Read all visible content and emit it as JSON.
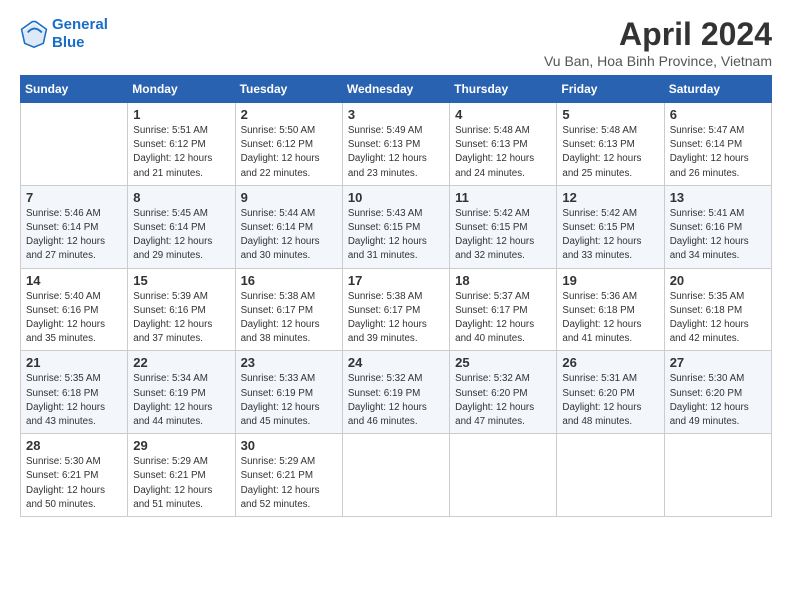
{
  "logo": {
    "line1": "General",
    "line2": "Blue"
  },
  "title": "April 2024",
  "subtitle": "Vu Ban, Hoa Binh Province, Vietnam",
  "headers": [
    "Sunday",
    "Monday",
    "Tuesday",
    "Wednesday",
    "Thursday",
    "Friday",
    "Saturday"
  ],
  "weeks": [
    [
      {
        "num": "",
        "sunrise": "",
        "sunset": "",
        "daylight": ""
      },
      {
        "num": "1",
        "sunrise": "Sunrise: 5:51 AM",
        "sunset": "Sunset: 6:12 PM",
        "daylight": "Daylight: 12 hours and 21 minutes."
      },
      {
        "num": "2",
        "sunrise": "Sunrise: 5:50 AM",
        "sunset": "Sunset: 6:12 PM",
        "daylight": "Daylight: 12 hours and 22 minutes."
      },
      {
        "num": "3",
        "sunrise": "Sunrise: 5:49 AM",
        "sunset": "Sunset: 6:13 PM",
        "daylight": "Daylight: 12 hours and 23 minutes."
      },
      {
        "num": "4",
        "sunrise": "Sunrise: 5:48 AM",
        "sunset": "Sunset: 6:13 PM",
        "daylight": "Daylight: 12 hours and 24 minutes."
      },
      {
        "num": "5",
        "sunrise": "Sunrise: 5:48 AM",
        "sunset": "Sunset: 6:13 PM",
        "daylight": "Daylight: 12 hours and 25 minutes."
      },
      {
        "num": "6",
        "sunrise": "Sunrise: 5:47 AM",
        "sunset": "Sunset: 6:14 PM",
        "daylight": "Daylight: 12 hours and 26 minutes."
      }
    ],
    [
      {
        "num": "7",
        "sunrise": "Sunrise: 5:46 AM",
        "sunset": "Sunset: 6:14 PM",
        "daylight": "Daylight: 12 hours and 27 minutes."
      },
      {
        "num": "8",
        "sunrise": "Sunrise: 5:45 AM",
        "sunset": "Sunset: 6:14 PM",
        "daylight": "Daylight: 12 hours and 29 minutes."
      },
      {
        "num": "9",
        "sunrise": "Sunrise: 5:44 AM",
        "sunset": "Sunset: 6:14 PM",
        "daylight": "Daylight: 12 hours and 30 minutes."
      },
      {
        "num": "10",
        "sunrise": "Sunrise: 5:43 AM",
        "sunset": "Sunset: 6:15 PM",
        "daylight": "Daylight: 12 hours and 31 minutes."
      },
      {
        "num": "11",
        "sunrise": "Sunrise: 5:42 AM",
        "sunset": "Sunset: 6:15 PM",
        "daylight": "Daylight: 12 hours and 32 minutes."
      },
      {
        "num": "12",
        "sunrise": "Sunrise: 5:42 AM",
        "sunset": "Sunset: 6:15 PM",
        "daylight": "Daylight: 12 hours and 33 minutes."
      },
      {
        "num": "13",
        "sunrise": "Sunrise: 5:41 AM",
        "sunset": "Sunset: 6:16 PM",
        "daylight": "Daylight: 12 hours and 34 minutes."
      }
    ],
    [
      {
        "num": "14",
        "sunrise": "Sunrise: 5:40 AM",
        "sunset": "Sunset: 6:16 PM",
        "daylight": "Daylight: 12 hours and 35 minutes."
      },
      {
        "num": "15",
        "sunrise": "Sunrise: 5:39 AM",
        "sunset": "Sunset: 6:16 PM",
        "daylight": "Daylight: 12 hours and 37 minutes."
      },
      {
        "num": "16",
        "sunrise": "Sunrise: 5:38 AM",
        "sunset": "Sunset: 6:17 PM",
        "daylight": "Daylight: 12 hours and 38 minutes."
      },
      {
        "num": "17",
        "sunrise": "Sunrise: 5:38 AM",
        "sunset": "Sunset: 6:17 PM",
        "daylight": "Daylight: 12 hours and 39 minutes."
      },
      {
        "num": "18",
        "sunrise": "Sunrise: 5:37 AM",
        "sunset": "Sunset: 6:17 PM",
        "daylight": "Daylight: 12 hours and 40 minutes."
      },
      {
        "num": "19",
        "sunrise": "Sunrise: 5:36 AM",
        "sunset": "Sunset: 6:18 PM",
        "daylight": "Daylight: 12 hours and 41 minutes."
      },
      {
        "num": "20",
        "sunrise": "Sunrise: 5:35 AM",
        "sunset": "Sunset: 6:18 PM",
        "daylight": "Daylight: 12 hours and 42 minutes."
      }
    ],
    [
      {
        "num": "21",
        "sunrise": "Sunrise: 5:35 AM",
        "sunset": "Sunset: 6:18 PM",
        "daylight": "Daylight: 12 hours and 43 minutes."
      },
      {
        "num": "22",
        "sunrise": "Sunrise: 5:34 AM",
        "sunset": "Sunset: 6:19 PM",
        "daylight": "Daylight: 12 hours and 44 minutes."
      },
      {
        "num": "23",
        "sunrise": "Sunrise: 5:33 AM",
        "sunset": "Sunset: 6:19 PM",
        "daylight": "Daylight: 12 hours and 45 minutes."
      },
      {
        "num": "24",
        "sunrise": "Sunrise: 5:32 AM",
        "sunset": "Sunset: 6:19 PM",
        "daylight": "Daylight: 12 hours and 46 minutes."
      },
      {
        "num": "25",
        "sunrise": "Sunrise: 5:32 AM",
        "sunset": "Sunset: 6:20 PM",
        "daylight": "Daylight: 12 hours and 47 minutes."
      },
      {
        "num": "26",
        "sunrise": "Sunrise: 5:31 AM",
        "sunset": "Sunset: 6:20 PM",
        "daylight": "Daylight: 12 hours and 48 minutes."
      },
      {
        "num": "27",
        "sunrise": "Sunrise: 5:30 AM",
        "sunset": "Sunset: 6:20 PM",
        "daylight": "Daylight: 12 hours and 49 minutes."
      }
    ],
    [
      {
        "num": "28",
        "sunrise": "Sunrise: 5:30 AM",
        "sunset": "Sunset: 6:21 PM",
        "daylight": "Daylight: 12 hours and 50 minutes."
      },
      {
        "num": "29",
        "sunrise": "Sunrise: 5:29 AM",
        "sunset": "Sunset: 6:21 PM",
        "daylight": "Daylight: 12 hours and 51 minutes."
      },
      {
        "num": "30",
        "sunrise": "Sunrise: 5:29 AM",
        "sunset": "Sunset: 6:21 PM",
        "daylight": "Daylight: 12 hours and 52 minutes."
      },
      {
        "num": "",
        "sunrise": "",
        "sunset": "",
        "daylight": ""
      },
      {
        "num": "",
        "sunrise": "",
        "sunset": "",
        "daylight": ""
      },
      {
        "num": "",
        "sunrise": "",
        "sunset": "",
        "daylight": ""
      },
      {
        "num": "",
        "sunrise": "",
        "sunset": "",
        "daylight": ""
      }
    ]
  ]
}
